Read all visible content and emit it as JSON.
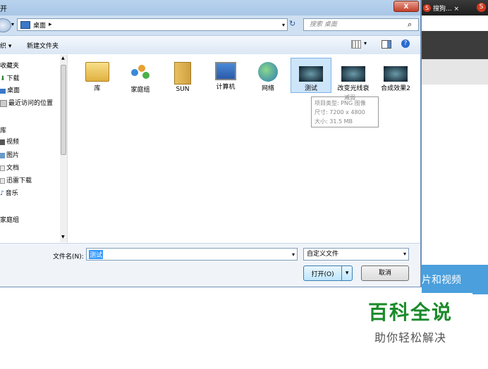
{
  "browser": {
    "tab_label": "搜狗... ×",
    "side_button": "片和视频"
  },
  "watermark": {
    "title": "百科全说",
    "subtitle": "助你轻松解决"
  },
  "dialog": {
    "title_char": "开",
    "close_symbol": "X",
    "address": {
      "location": "桌面",
      "arrow": "▸"
    },
    "search_placeholder": "搜索 桌面",
    "toolbar": {
      "organize_fragment": "织 ▾",
      "new_folder": "新建文件夹"
    },
    "nav": {
      "items": [
        {
          "icon": "star-icon",
          "label": "收藏夹"
        },
        {
          "icon": "download-icon",
          "label": "下载"
        },
        {
          "icon": "desktop-icon",
          "label": "桌面"
        },
        {
          "icon": "recent-icon",
          "label": "最近访问的位置"
        },
        {
          "icon": "",
          "label": "库"
        },
        {
          "icon": "video-icon",
          "label": "视频"
        },
        {
          "icon": "image-icon",
          "label": "图片"
        },
        {
          "icon": "document-icon",
          "label": "文档"
        },
        {
          "icon": "download-icon",
          "label": "迅雷下载"
        },
        {
          "icon": "music-icon",
          "label": "音乐"
        },
        {
          "icon": "",
          "label": "家庭组"
        }
      ]
    },
    "files": [
      {
        "icon": "library-icon",
        "label": "库"
      },
      {
        "icon": "homegroup-icon",
        "label": "家庭组"
      },
      {
        "icon": "user-folder-icon",
        "label": "SUN"
      },
      {
        "icon": "computer-icon",
        "label": "计算机"
      },
      {
        "icon": "network-icon",
        "label": "网络"
      },
      {
        "icon": "image-thumb-icon",
        "label": "测试"
      },
      {
        "icon": "image-thumb-icon",
        "label": "改变光线衰"
      },
      {
        "icon": "image-thumb-icon",
        "label": "合成效果2"
      }
    ],
    "tooltip": {
      "type": "项目类型: PNG 图像",
      "size_dim": "尺寸: 7200 x 4800",
      "size_file": "大小: 31.5 MB",
      "overflow_label": "减弱"
    },
    "bottom": {
      "filename_label": "文件名(N):",
      "filename_value": "测试",
      "filter_value": "自定义文件",
      "open_label": "打开(O)",
      "cancel_label": "取消"
    }
  }
}
